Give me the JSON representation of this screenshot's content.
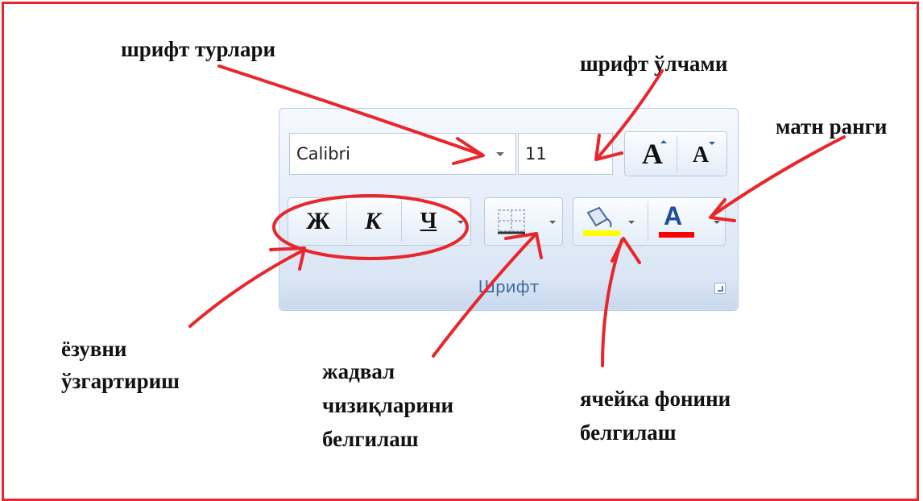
{
  "annotations": {
    "font_types": "шрифт турлари",
    "font_size": "шрифт ўлчами",
    "text_color": "матн ранги",
    "change_style_line1": "ёзувни",
    "change_style_line2": "ўзгартириш",
    "borders_line1": "жадвал",
    "borders_line2": "чизиқларини",
    "borders_line3": "белгилаш",
    "fill_line1": "ячейка фонини",
    "fill_line2": "белгилаш"
  },
  "ribbon": {
    "group_title": "Шрифт",
    "font_name": "Calibri",
    "font_size": "11",
    "grow_font": "A",
    "shrink_font": "A",
    "bold": "Ж",
    "italic": "К",
    "underline": "Ч",
    "font_color_glyph": "A"
  },
  "colors": {
    "frame": "#e8262b",
    "annotation_ink": "#e8262b",
    "fill_swatch": "#ffff00",
    "font_color_swatch": "#ff0000",
    "group_title": "#3f69a1"
  }
}
